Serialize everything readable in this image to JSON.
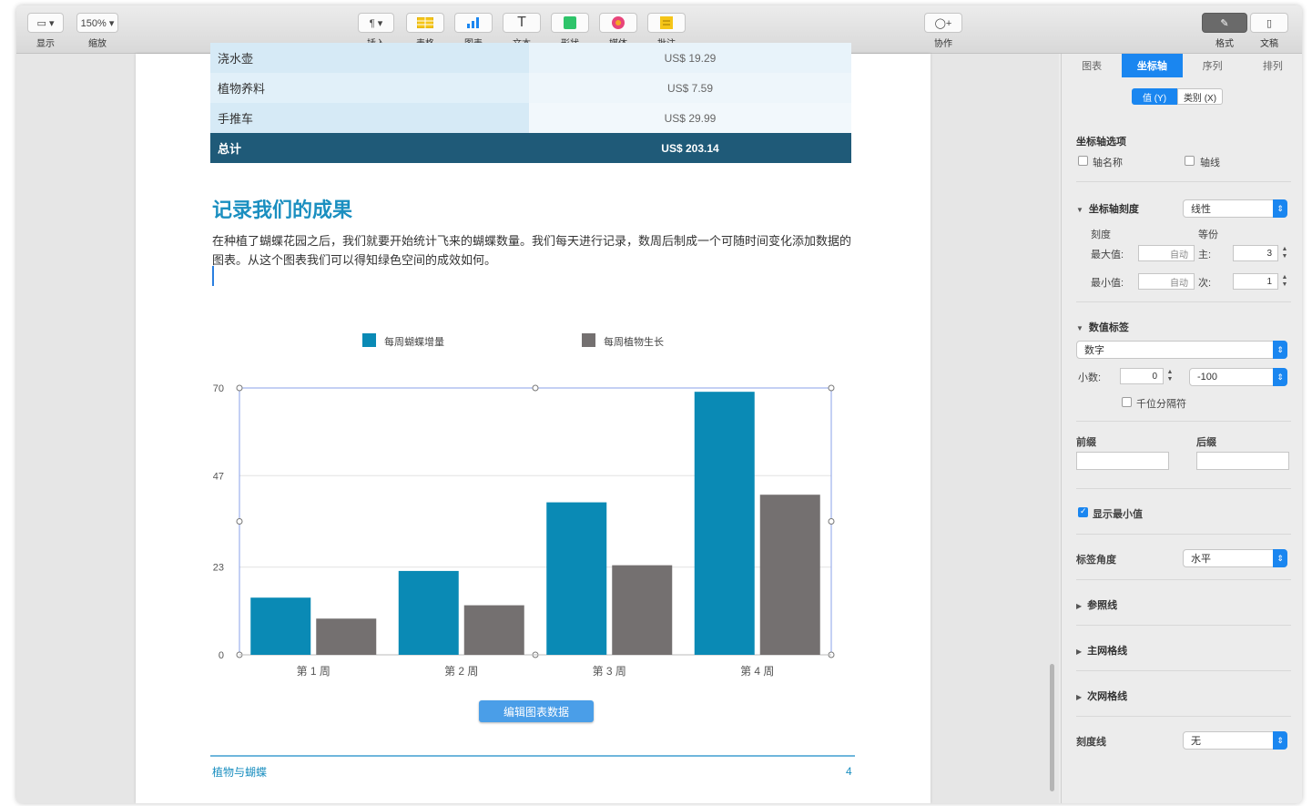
{
  "toolbar": {
    "view": {
      "label": "显示",
      "button": "▭ ▾"
    },
    "zoom": {
      "label": "缩放",
      "value": "150% ▾"
    },
    "insert": {
      "label": "插入",
      "icon": "paragraph-icon"
    },
    "table": {
      "label": "表格",
      "icon": "table-icon"
    },
    "chart": {
      "label": "图表",
      "icon": "chart-icon"
    },
    "text": {
      "label": "文本",
      "icon": "text-icon"
    },
    "shape": {
      "label": "形状",
      "icon": "shape-icon"
    },
    "media": {
      "label": "媒体",
      "icon": "media-icon"
    },
    "comment": {
      "label": "批注",
      "icon": "comment-icon"
    },
    "collaborate": {
      "label": "协作",
      "icon": "collaborate-icon"
    },
    "format": {
      "label": "格式",
      "icon": "paintbrush-icon"
    },
    "document": {
      "label": "文稿",
      "icon": "document-icon"
    }
  },
  "table": {
    "rows": [
      {
        "name": "浇水壶",
        "price": "US$ 19.29"
      },
      {
        "name": "植物养料",
        "price": "US$ 7.59"
      },
      {
        "name": "手推车",
        "price": "US$ 29.99"
      }
    ],
    "total": {
      "name": "总计",
      "price": "US$ 203.14"
    }
  },
  "document": {
    "heading": "记录我们的成果",
    "paragraph": "在种植了蝴蝶花园之后，我们就要开始统计飞来的蝴蝶数量。我们每天进行记录，数周后制成一个可随时间变化添加数据的图表。从这个图表我们可以得知绿色空间的成效如何。",
    "edit_chart_button": "编辑图表数据",
    "footer_left": "植物与蝴蝶",
    "footer_page": "4"
  },
  "chart_data": {
    "type": "bar",
    "categories": [
      "第 1 周",
      "第 2 周",
      "第 3 周",
      "第 4 周"
    ],
    "series": [
      {
        "name": "每周蝴蝶增量",
        "color": "#0a8ab5",
        "values": [
          15,
          22,
          40,
          69
        ]
      },
      {
        "name": "每周植物生长",
        "color": "#747070",
        "values": [
          9.5,
          13,
          23.5,
          42
        ]
      }
    ],
    "yticks": [
      0,
      23,
      47,
      70
    ],
    "ylim": [
      0,
      70
    ],
    "grid": true,
    "legend": "top"
  },
  "inspector": {
    "tabs": [
      "图表",
      "坐标轴",
      "序列",
      "排列"
    ],
    "active_tab": "坐标轴",
    "axis_segments": [
      "值 (Y)",
      "类别 (X)"
    ],
    "axis_options": {
      "title": "坐标轴选项",
      "axis_name": "轴名称",
      "axis_line": "轴线"
    },
    "axis_scale": {
      "title": "坐标轴刻度",
      "type": "线性",
      "scale_label": "刻度",
      "steps_label": "等份",
      "max_label": "最大值:",
      "max_value": "自动",
      "min_label": "最小值:",
      "min_value": "自动",
      "major_label": "主:",
      "major_value": "3",
      "minor_label": "次:",
      "minor_value": "1"
    },
    "value_labels": {
      "title": "数值标签",
      "format": "数字",
      "decimals_label": "小数:",
      "decimals_value": "0",
      "negative": "-100",
      "thousands": "千位分隔符"
    },
    "prefix_label": "前缀",
    "suffix_label": "后缀",
    "show_minmax": "显示最小值",
    "label_angle": {
      "label": "标签角度",
      "value": "水平"
    },
    "gridlines_ref": "参照线",
    "major_gridlines": "主网格线",
    "minor_gridlines": "次网格线",
    "tick_marks": {
      "label": "刻度线",
      "value": "无"
    }
  }
}
